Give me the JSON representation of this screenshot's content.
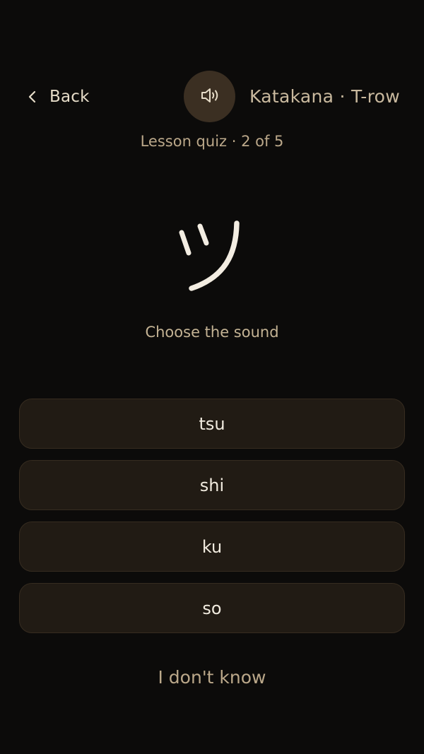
{
  "header": {
    "back_label": "Back",
    "lesson_title": "Katakana · T-row",
    "sound_icon": "speaker-icon"
  },
  "progress": {
    "label": "Lesson quiz · 2 of 5"
  },
  "quiz": {
    "character": "ツ",
    "prompt": "Choose the sound",
    "options": [
      {
        "label": "tsu"
      },
      {
        "label": "shi"
      },
      {
        "label": "ku"
      },
      {
        "label": "so"
      }
    ],
    "dont_know_label": "I don't know"
  },
  "colors": {
    "background": "#0c0b0a",
    "accent": "#c9b99e",
    "option_bg": "#211b14",
    "sound_button_bg": "#3b2f22"
  }
}
